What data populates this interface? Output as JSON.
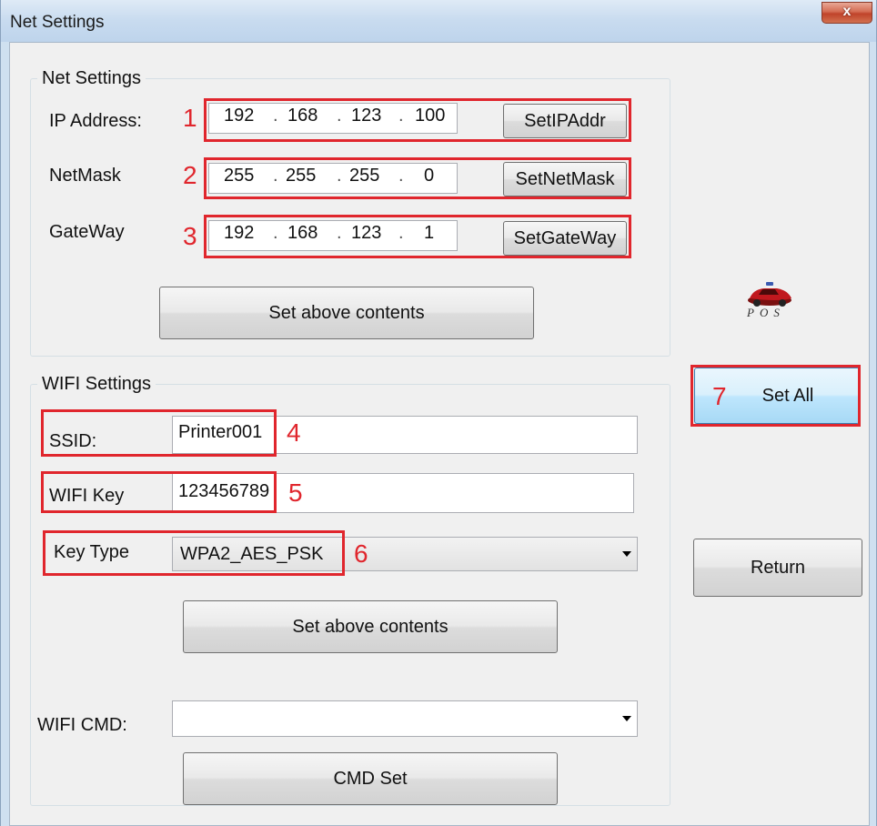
{
  "window": {
    "title": "Net Settings",
    "close_glyph": "x"
  },
  "net_settings": {
    "group_label": "Net Settings",
    "ip_address": {
      "label": "IP Address:",
      "octets": [
        "192",
        "168",
        "123",
        "100"
      ],
      "button": "SetIPAddr",
      "marker": "1"
    },
    "netmask": {
      "label": "NetMask",
      "octets": [
        "255",
        "255",
        "255",
        "0"
      ],
      "button": "SetNetMask",
      "marker": "2"
    },
    "gateway": {
      "label": "GateWay",
      "octets": [
        "192",
        "168",
        "123",
        "1"
      ],
      "button": "SetGateWay",
      "marker": "3"
    },
    "separator": ".",
    "set_button": "Set above contents"
  },
  "logo": {
    "text": "POS",
    "icon": "car-icon"
  },
  "wifi_settings": {
    "group_label": "WIFI Settings",
    "ssid": {
      "label": "SSID:",
      "value": "Printer001",
      "marker": "4"
    },
    "wifi_key": {
      "label": "WIFI Key",
      "value": "123456789",
      "marker": "5"
    },
    "key_type": {
      "label": "Key Type",
      "value": "WPA2_AES_PSK",
      "marker": "6"
    },
    "set_button": "Set above contents",
    "wifi_cmd": {
      "label": "WIFI CMD:",
      "value": ""
    },
    "cmd_button": "CMD Set"
  },
  "actions": {
    "set_all": "Set All",
    "set_all_marker": "7",
    "return": "Return"
  },
  "colors": {
    "annotation_red": "#e0262d",
    "title_bar": "#c8dbef",
    "close_button": "#c0432a"
  }
}
